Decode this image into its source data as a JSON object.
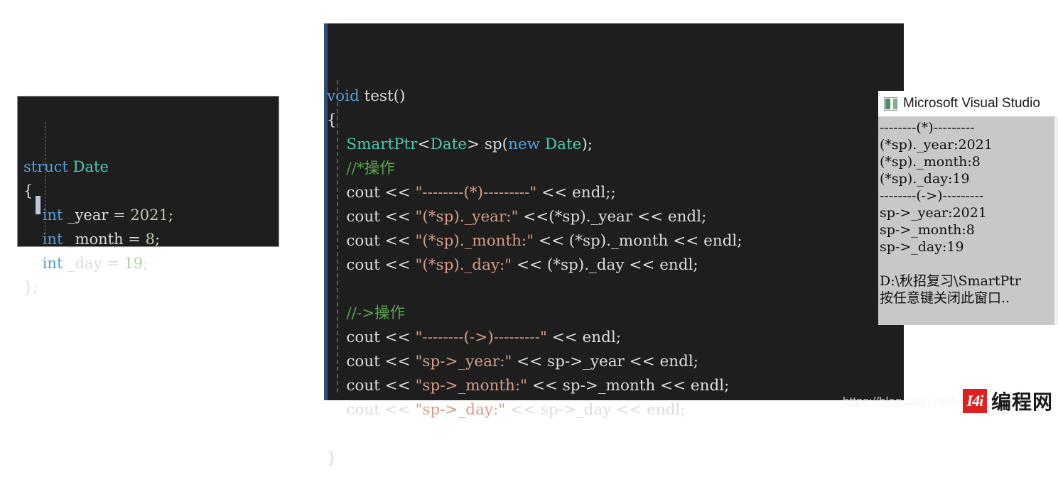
{
  "struct_snippet": {
    "lines": [
      [
        {
          "t": "struct ",
          "c": "kw"
        },
        {
          "t": "Date",
          "c": "type"
        }
      ],
      [
        {
          "t": "{",
          "c": "punc"
        }
      ],
      [
        {
          "t": "    ",
          "c": "punc"
        },
        {
          "t": "int",
          "c": "kw"
        },
        {
          "t": " _year = ",
          "c": "id"
        },
        {
          "t": "2021",
          "c": "num"
        },
        {
          "t": ";",
          "c": "punc"
        }
      ],
      [
        {
          "t": "    ",
          "c": "punc"
        },
        {
          "t": "int",
          "c": "kw"
        },
        {
          "t": " _month = ",
          "c": "id"
        },
        {
          "t": "8",
          "c": "num"
        },
        {
          "t": ";",
          "c": "punc"
        }
      ],
      [
        {
          "t": "    ",
          "c": "punc"
        },
        {
          "t": "int",
          "c": "kw"
        },
        {
          "t": " _day = ",
          "c": "id"
        },
        {
          "t": "19",
          "c": "num"
        },
        {
          "t": ";",
          "c": "punc"
        }
      ],
      [
        {
          "t": "};",
          "c": "punc"
        }
      ]
    ]
  },
  "main_snippet": {
    "lines": [
      [
        {
          "t": "void",
          "c": "kw"
        },
        {
          "t": " test()",
          "c": "id"
        }
      ],
      [
        {
          "t": "{",
          "c": "punc"
        }
      ],
      [
        {
          "t": "    ",
          "c": "punc"
        },
        {
          "t": "SmartPtr",
          "c": "type"
        },
        {
          "t": "<",
          "c": "punc"
        },
        {
          "t": "Date",
          "c": "type"
        },
        {
          "t": "> sp(",
          "c": "id"
        },
        {
          "t": "new",
          "c": "kw"
        },
        {
          "t": " ",
          "c": "id"
        },
        {
          "t": "Date",
          "c": "type"
        },
        {
          "t": ");",
          "c": "punc"
        }
      ],
      [
        {
          "t": "    ",
          "c": "punc"
        },
        {
          "t": "//*操作",
          "c": "cmt"
        }
      ],
      [
        {
          "t": "    cout << ",
          "c": "id"
        },
        {
          "t": "\"--------(*)---------\"",
          "c": "str"
        },
        {
          "t": " << endl;;",
          "c": "id"
        }
      ],
      [
        {
          "t": "    cout << ",
          "c": "id"
        },
        {
          "t": "\"(*sp)._year:\"",
          "c": "str"
        },
        {
          "t": " <<(*sp)._year << endl;",
          "c": "id"
        }
      ],
      [
        {
          "t": "    cout << ",
          "c": "id"
        },
        {
          "t": "\"(*sp)._month:\"",
          "c": "str"
        },
        {
          "t": " << (*sp)._month << endl;",
          "c": "id"
        }
      ],
      [
        {
          "t": "    cout << ",
          "c": "id"
        },
        {
          "t": "\"(*sp)._day:\"",
          "c": "str"
        },
        {
          "t": " << (*sp)._day << endl;",
          "c": "id"
        }
      ],
      [
        {
          "t": "",
          "c": "id"
        }
      ],
      [
        {
          "t": "    ",
          "c": "punc"
        },
        {
          "t": "//->操作",
          "c": "cmt"
        }
      ],
      [
        {
          "t": "    cout << ",
          "c": "id"
        },
        {
          "t": "\"--------(->)---------\"",
          "c": "str"
        },
        {
          "t": " << endl;",
          "c": "id"
        }
      ],
      [
        {
          "t": "    cout << ",
          "c": "id"
        },
        {
          "t": "\"sp->_year:\"",
          "c": "str"
        },
        {
          "t": " << sp->_year << endl;",
          "c": "id"
        }
      ],
      [
        {
          "t": "    cout << ",
          "c": "id"
        },
        {
          "t": "\"sp->_month:\"",
          "c": "str"
        },
        {
          "t": " << sp->_month << endl;",
          "c": "id"
        }
      ],
      [
        {
          "t": "    cout << ",
          "c": "id"
        },
        {
          "t": "\"sp->_day:\"",
          "c": "str"
        },
        {
          "t": " << sp->_day << endl;",
          "c": "id"
        }
      ],
      [
        {
          "t": "",
          "c": "id"
        }
      ],
      [
        {
          "t": "}",
          "c": "punc"
        }
      ]
    ]
  },
  "console": {
    "title": "Microsoft Visual Studio",
    "icon": "visual-studio-console-icon",
    "output_lines": [
      "--------(*)---------",
      "(*sp)._year:2021",
      "(*sp)._month:8",
      "(*sp)._day:19",
      "--------(->)---------",
      "sp->_year:2021",
      "sp->_month:8",
      "sp->_day:19",
      "",
      "D:\\秋招复习\\SmartPtr",
      "按任意键关闭此窗口.."
    ]
  },
  "watermark": {
    "url": "https://blog.csdn.net/w",
    "brand_mark": "I4i",
    "brand_name": "编程网"
  },
  "colors": {
    "code_bg": "#1e1e1e",
    "keyword": "#569cd6",
    "type": "#4ec9b0",
    "string": "#d69d85",
    "number": "#b5cea8",
    "comment": "#57a64a",
    "console_bg": "#c8c8c8",
    "brand_red": "#e02020"
  }
}
